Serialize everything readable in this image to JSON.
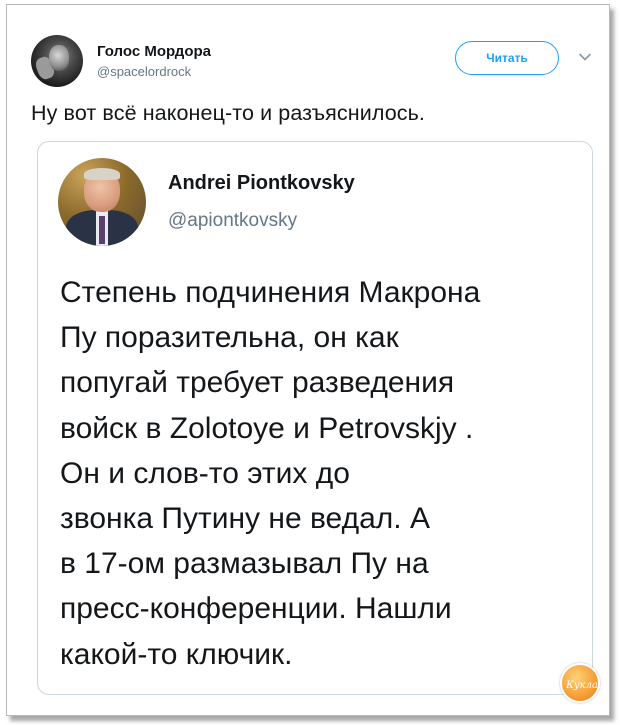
{
  "tweet": {
    "author_name": "Голос Мордора",
    "author_handle": "@spacelordrock",
    "follow_label": "Читать",
    "text": "Ну вот всё наконец-то и разъяснилось."
  },
  "quoted_tweet": {
    "author_name": "Andrei Piontkovsky",
    "author_handle": "@apiontkovsky",
    "lines": [
      "Степень подчинения Макрона",
      "Пу поразительна, он как",
      "попугай требует разведения",
      "войск в Zolotoye  и Petrovskjy .",
      "Он и слов-то этих до",
      "звонка Путину не ведал. А",
      "в 17-ом размазывал Пу на",
      "пресс-конференции. Нашли",
      "какой-то ключик."
    ]
  },
  "watermark": {
    "text": "Кукла"
  },
  "colors": {
    "accent": "#1da1f2",
    "secondary_text": "#657786",
    "card_border": "#ccd6dd",
    "watermark": "#f6a23a"
  }
}
